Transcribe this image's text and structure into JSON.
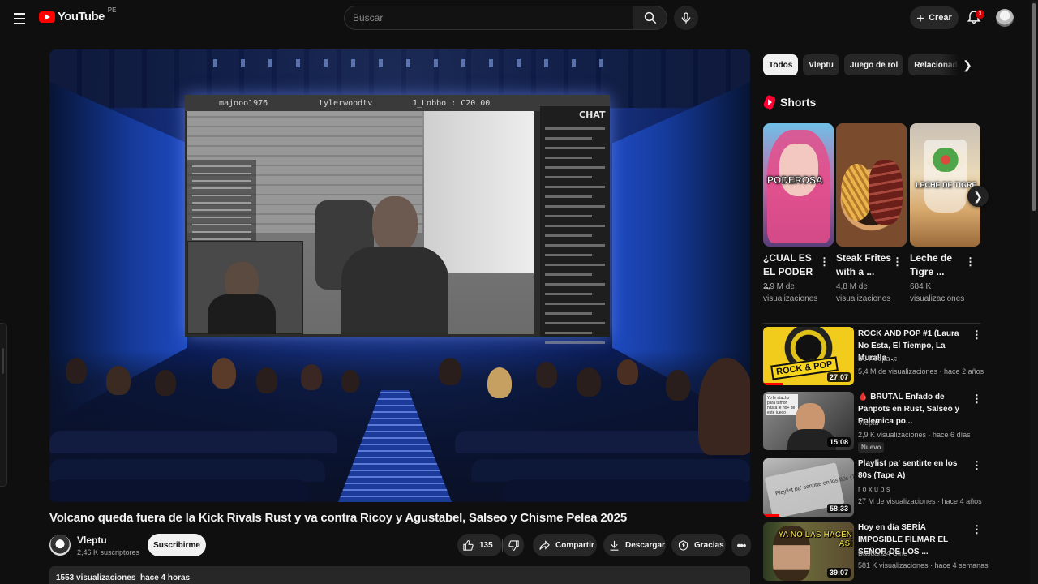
{
  "header": {
    "logo_text": "YouTube",
    "country": "PE",
    "search_placeholder": "Buscar",
    "create_label": "Crear",
    "notifications": "3"
  },
  "video": {
    "title": "Volcano queda fuera de la Kick Rivals Rust y va contra Ricoy y Agustabel, Salseo y Chisme Pelea 2025",
    "stream_users": [
      "majooo1976",
      "tylerwoodtv",
      "J_Lobbo : C20.00"
    ],
    "chat_title": "CHAT",
    "channel": "Vleptu",
    "subscribers": "2,46 K suscriptores",
    "subscribe_label": "Suscribirme",
    "likes": "135",
    "share_label": "Compartir",
    "download_label": "Descargar",
    "thanks_label": "Gracias",
    "views": "1553 visualizaciones",
    "time_ago": "hace 4 horas"
  },
  "chips": [
    "Todos",
    "Vleptu",
    "Juego de rol",
    "Relacionados"
  ],
  "shorts": {
    "heading": "Shorts",
    "items": [
      {
        "thumb_text": "PODEROSA",
        "title": "¿CUAL ES EL PODER ...",
        "views": "2,9 M de visualizaciones"
      },
      {
        "thumb_text": "",
        "title": "Steak Frites with a ...",
        "views": "4,8 M de visualizaciones"
      },
      {
        "thumb_text": "LECHE DE TIGRE",
        "title": "Leche de Tigre ...",
        "views": "684 K visualizaciones"
      }
    ]
  },
  "related": [
    {
      "title": "ROCK AND POP #1 (Laura No Esta, El Tiempo, La Muralla ...",
      "channel": "DJ Koopa ♫",
      "meta": "5,4 M de visualizaciones · hace 2 años",
      "duration": "27:07",
      "thumb_text": "ROCK & POP",
      "badge": ""
    },
    {
      "title": "🩸 BRUTAL Enfado de Panpots en Rust, Salseo y Polemica po...",
      "channel": "Vleptu",
      "meta": "2,9 K visualizaciones · hace 6 días",
      "duration": "15:08",
      "thumb_text": "Yo le atacho para tumor hasta le no+ de este juego",
      "badge": "Nuevo"
    },
    {
      "title": "Playlist pa' sentirte en los 80s (Tape A)",
      "channel": "r o x u b s",
      "meta": "27 M de visualizaciones · hace 4 años",
      "duration": "58:33",
      "thumb_text": "Playlist pa' sentirte en los 80s (Tape A)",
      "badge": ""
    },
    {
      "title": "Hoy en día SERÍA IMPOSIBLE FILMAR EL SEÑOR DE LOS ...",
      "channel": "Bastian24 Cine",
      "meta": "581 K visualizaciones · hace 4 semanas",
      "duration": "39:07",
      "thumb_text": "YA NO LAS HACEN ASÍ",
      "badge": ""
    }
  ]
}
